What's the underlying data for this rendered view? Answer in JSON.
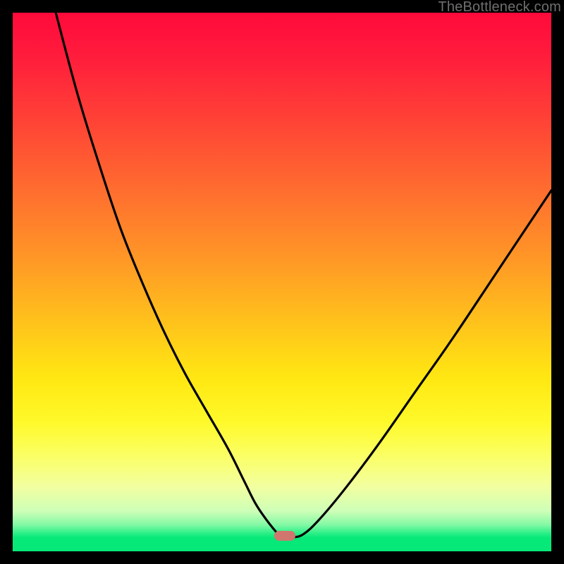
{
  "watermark": "TheBottleneck.com",
  "marker": {
    "x_frac": 0.505,
    "y_frac": 0.971,
    "color": "#d1766f"
  },
  "chart_data": {
    "type": "line",
    "title": "",
    "xlabel": "",
    "ylabel": "",
    "xlim": [
      0,
      100
    ],
    "ylim": [
      0,
      100
    ],
    "grid": false,
    "legend": false,
    "series": [
      {
        "name": "curve",
        "x": [
          8,
          12,
          16,
          20,
          24,
          28,
          32,
          36,
          40,
          43,
          45,
          47,
          49,
          50,
          52,
          54,
          57,
          62,
          68,
          75,
          82,
          90,
          100
        ],
        "y": [
          100,
          85,
          72,
          60,
          50,
          41,
          33,
          26,
          19,
          13,
          9,
          6,
          3.5,
          2.6,
          2.6,
          3.2,
          6,
          12,
          20,
          30,
          40,
          52,
          67
        ]
      }
    ],
    "background_gradient": {
      "stops": [
        {
          "pos": 0.0,
          "color": "#ff0a3b"
        },
        {
          "pos": 0.2,
          "color": "#ff4236"
        },
        {
          "pos": 0.46,
          "color": "#ff9826"
        },
        {
          "pos": 0.68,
          "color": "#ffe812"
        },
        {
          "pos": 0.88,
          "color": "#f2ffa0"
        },
        {
          "pos": 0.97,
          "color": "#06e878"
        },
        {
          "pos": 1.0,
          "color": "#06e878"
        }
      ]
    },
    "marker_point": {
      "x": 50.5,
      "y": 2.9
    }
  }
}
